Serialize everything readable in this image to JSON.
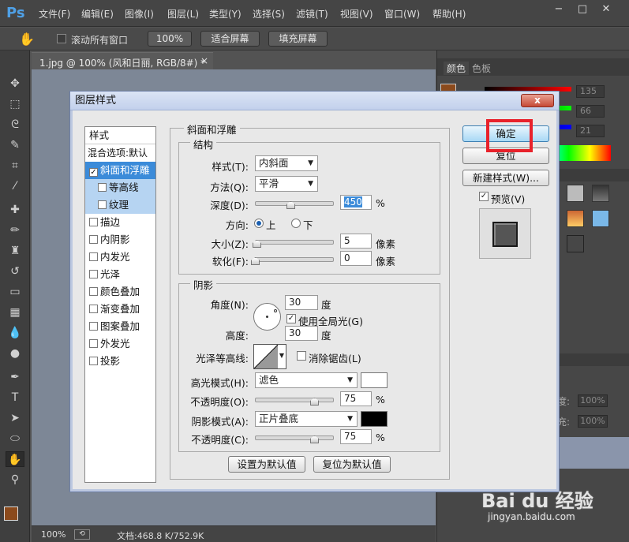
{
  "app": {
    "logo": "Ps",
    "menus": [
      "文件(F)",
      "编辑(E)",
      "图像(I)",
      "图层(L)",
      "类型(Y)",
      "选择(S)",
      "滤镜(T)",
      "视图(V)",
      "窗口(W)",
      "帮助(H)"
    ],
    "window_controls": [
      "−",
      "□",
      "✕"
    ]
  },
  "options": {
    "scroll_all": "滚动所有窗口",
    "zoom_100": "100%",
    "fit_screen": "适合屏幕",
    "fill_screen": "填充屏幕"
  },
  "document": {
    "tab_label": "1.jpg @ 100% (风和日丽, RGB/8#) *",
    "close": "×"
  },
  "status": {
    "zoom": "100%",
    "doc_size": "文档:468.8 K/752.9K"
  },
  "right_panel": {
    "tab_color": "颜色",
    "tab_swatches": "色板",
    "values": [
      "135",
      "66",
      "21"
    ],
    "pct1": "100%",
    "pct2": "100%",
    "pct_label1": "度:",
    "pct_label2": "充:"
  },
  "dialog": {
    "title": "图层样式",
    "close": "x",
    "styles_list": {
      "header": "样式",
      "blend": "混合选项:默认",
      "items": [
        {
          "label": "斜面和浮雕",
          "checked": true,
          "selected": true
        },
        {
          "label": "等高线",
          "checked": false,
          "sub": true
        },
        {
          "label": "纹理",
          "checked": false,
          "sub": true
        },
        {
          "label": "描边",
          "checked": false
        },
        {
          "label": "内阴影",
          "checked": false
        },
        {
          "label": "内发光",
          "checked": false
        },
        {
          "label": "光泽",
          "checked": false
        },
        {
          "label": "颜色叠加",
          "checked": false
        },
        {
          "label": "渐变叠加",
          "checked": false
        },
        {
          "label": "图案叠加",
          "checked": false
        },
        {
          "label": "外发光",
          "checked": false
        },
        {
          "label": "投影",
          "checked": false
        }
      ]
    },
    "bevel": {
      "group_title": "斜面和浮雕",
      "structure_title": "结构",
      "style_label": "样式(T):",
      "style_value": "内斜面",
      "technique_label": "方法(Q):",
      "technique_value": "平滑",
      "depth_label": "深度(D):",
      "depth_value": "450",
      "depth_slider": 0.45,
      "percent": "%",
      "direction_label": "方向:",
      "dir_up": "上",
      "dir_down": "下",
      "size_label": "大小(Z):",
      "size_value": "5",
      "size_slider": 0.02,
      "px": "像素",
      "soften_label": "软化(F):",
      "soften_value": "0",
      "soften_slider": 0.0
    },
    "shading": {
      "title": "阴影",
      "angle_label": "角度(N):",
      "angle_value": "30",
      "deg": "度",
      "global_light": "使用全局光(G)",
      "altitude_label": "高度:",
      "altitude_value": "30",
      "gloss_label": "光泽等高线:",
      "anti_alias": "消除锯齿(L)",
      "highlight_mode_label": "高光模式(H):",
      "highlight_mode_value": "滤色",
      "highlight_color": "#ffffff",
      "opacity_label": "不透明度(O):",
      "opacity_value": "75",
      "opacity_slider": 0.75,
      "shadow_mode_label": "阴影模式(A):",
      "shadow_mode_value": "正片叠底",
      "shadow_color": "#000000",
      "opacity2_label": "不透明度(C):",
      "opacity2_value": "75",
      "opacity2_slider": 0.75
    },
    "make_default": "设置为默认值",
    "reset_default": "复位为默认值",
    "ok": "确定",
    "reset": "复位",
    "new_style": "新建样式(W)...",
    "preview": "预览(V)"
  },
  "watermark": {
    "brand": "Bai du 经验",
    "url": "jingyan.baidu.com"
  }
}
